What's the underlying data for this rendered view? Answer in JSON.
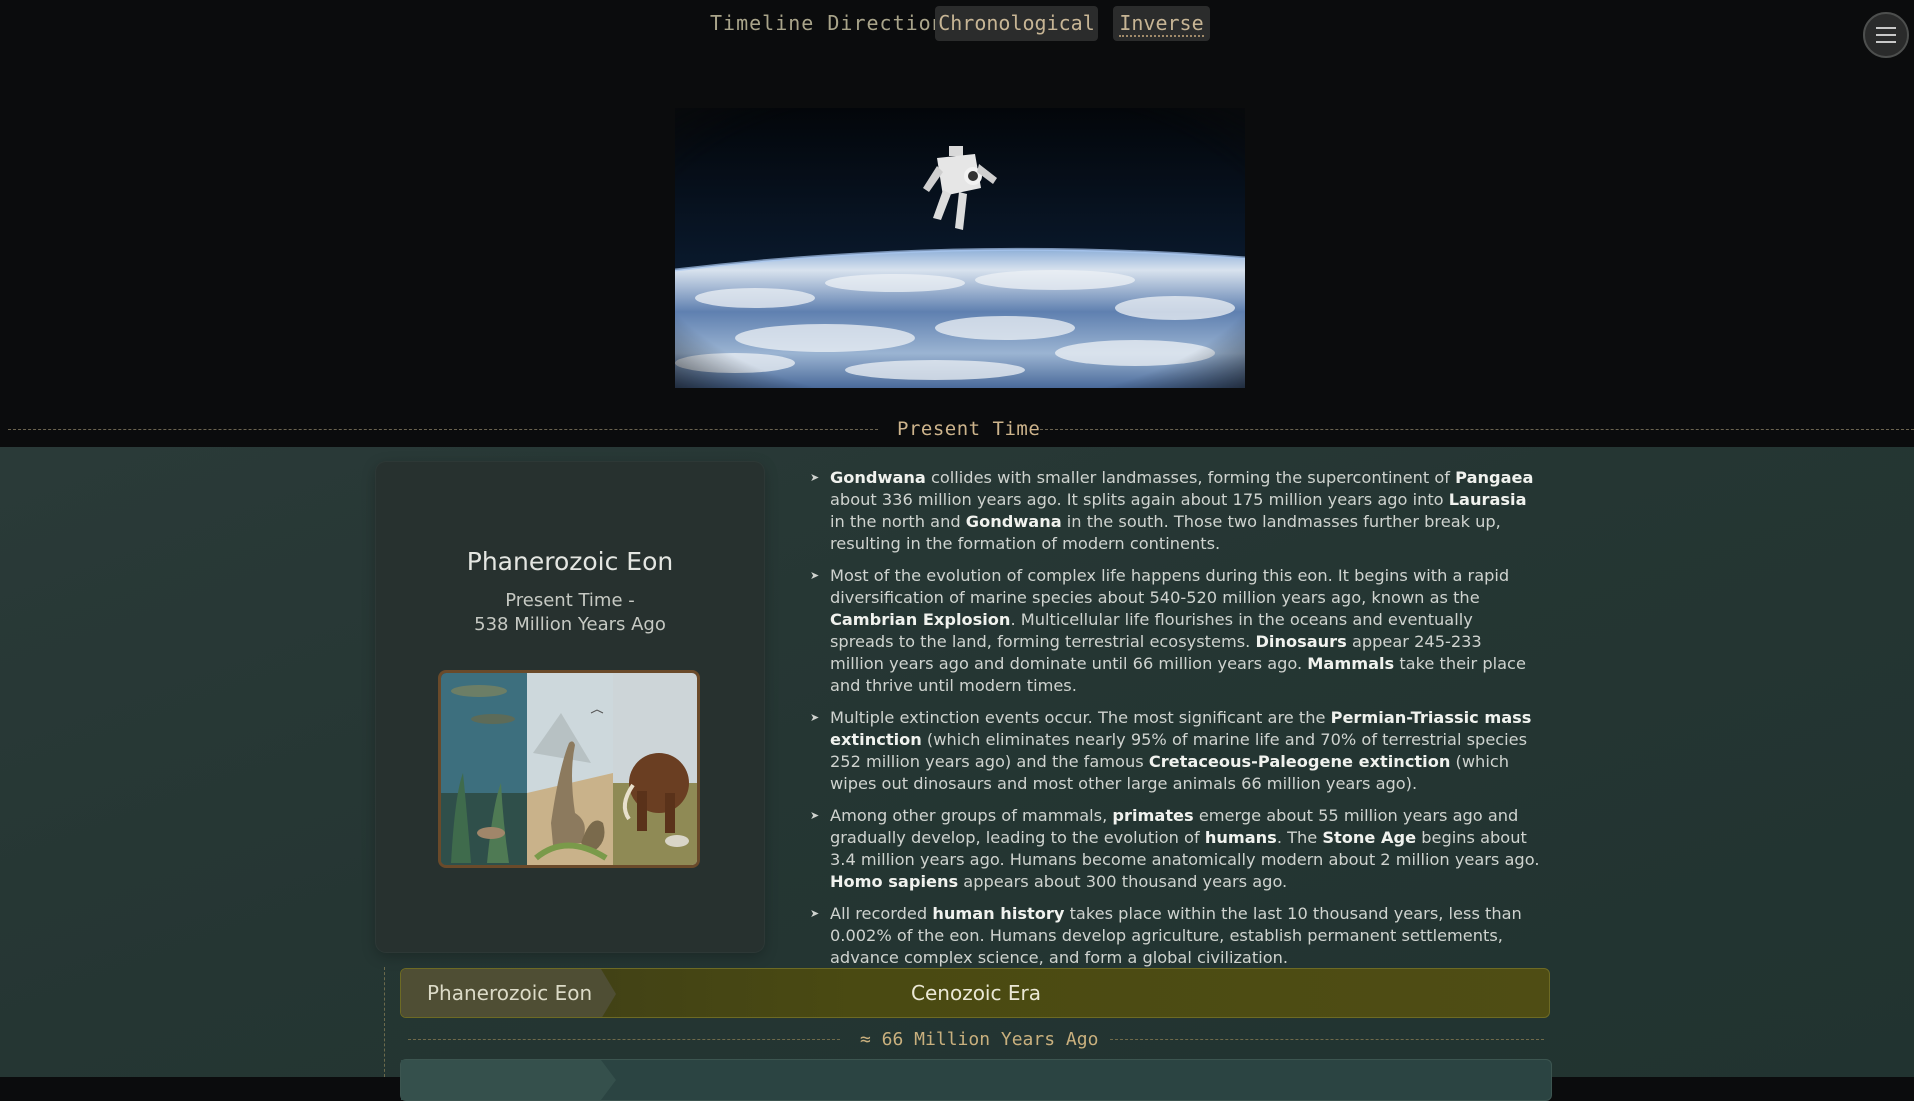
{
  "timeline": {
    "label": "Timeline Direction:",
    "options": [
      "Chronological",
      "Inverse"
    ],
    "selected": "Inverse"
  },
  "menu": {
    "icon": "hamburger-menu-icon"
  },
  "hero": {
    "image": "astronaut-floating-above-earth"
  },
  "divider_top": "Present Time",
  "eon_card": {
    "title": "Phanerozoic Eon",
    "range_line1": "Present Time -",
    "range_line2": "538 Million Years Ago",
    "image": "marine-life-dinosaurs-mammoth-collage"
  },
  "facts": [
    [
      {
        "b": "Gondwana"
      },
      " collides with smaller landmasses, forming the supercontinent of ",
      {
        "b": "Pangaea"
      },
      " about 336 million years ago. It splits again about 175 million years ago into ",
      {
        "b": "Laurasia"
      },
      " in the north and ",
      {
        "b": "Gondwana"
      },
      " in the south. Those two landmasses further break up, resulting in the formation of modern continents."
    ],
    [
      "Most of the evolution of complex life happens during this eon. It begins with a rapid diversification of marine species about 540-520 million years ago, known as the ",
      {
        "b": "Cambrian Explosion"
      },
      ". Multicellular life flourishes in the oceans and eventually spreads to the land, forming terrestrial ecosystems. ",
      {
        "b": "Dinosaurs"
      },
      " appear 245-233 million years ago and dominate until 66 million years ago. ",
      {
        "b": "Mammals"
      },
      " take their place and thrive until modern times."
    ],
    [
      "Multiple extinction events occur. The most significant are the ",
      {
        "b": "Permian-Triassic mass extinction"
      },
      " (which eliminates nearly 95% of marine life and 70% of terrestrial species 252 million years ago) and the famous ",
      {
        "b": "Cretaceous-Paleogene extinction"
      },
      " (which wipes out dinosaurs and most other large animals 66 million years ago)."
    ],
    [
      "Among other groups of mammals, ",
      {
        "b": "primates"
      },
      " emerge about 55 million years ago and gradually develop, leading to the evolution of ",
      {
        "b": "humans"
      },
      ". The ",
      {
        "b": "Stone Age"
      },
      " begins about 3.4 million years ago. Humans become anatomically modern about 2 million years ago. ",
      {
        "b": "Homo sapiens"
      },
      " appears about 300 thousand years ago."
    ],
    [
      "All recorded ",
      {
        "b": "human history"
      },
      " takes place within the last 10 thousand years, less than 0.002% of the eon. Humans develop agriculture, establish permanent settlements, advance complex science, and form a global civilization."
    ]
  ],
  "era_bar": {
    "eon": "Phanerozoic Eon",
    "era": "Cenozoic Era"
  },
  "divider_mya": "≈ 66 Million Years Ago",
  "colors": {
    "background": "#0b0c0d",
    "section": "#253633",
    "accent_gold": "#cdb48c",
    "era_bar": "#4a4a12"
  }
}
